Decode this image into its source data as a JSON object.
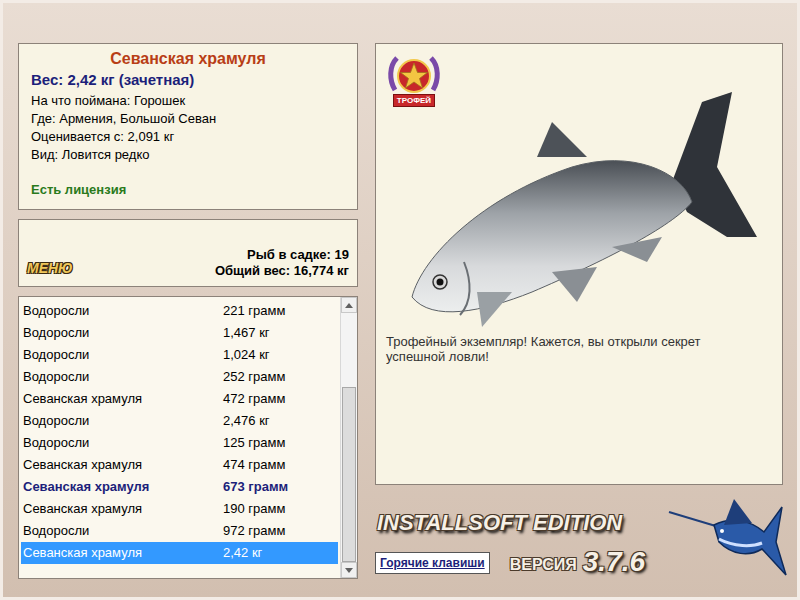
{
  "fish": {
    "name": "Севанская храмуля",
    "weight": "Вес: 2,42 кг (зачетная)",
    "details": [
      "На что поймана: Горошек",
      "Где: Армения, Большой Севан",
      "Оценивается с: 2,091 кг",
      "Вид: Ловится редко"
    ],
    "license": "Есть лицензия"
  },
  "keepnet": {
    "menu_button": "МЕНЮ",
    "count": "Рыб в садке: 19",
    "total": "Общий вес: 16,774 кг"
  },
  "catch_list": {
    "scroll": {
      "level": 1
    },
    "rows": [
      {
        "name": "Водоросли",
        "weight": "221 грамм",
        "highlighted": false,
        "selected": false
      },
      {
        "name": "Водоросли",
        "weight": "1,467 кг",
        "highlighted": false,
        "selected": false
      },
      {
        "name": "Водоросли",
        "weight": "1,024 кг",
        "highlighted": false,
        "selected": false
      },
      {
        "name": "Водоросли",
        "weight": "252 грамм",
        "highlighted": false,
        "selected": false
      },
      {
        "name": "Севанская храмуля",
        "weight": "472 грамм",
        "highlighted": false,
        "selected": false
      },
      {
        "name": "Водоросли",
        "weight": "2,476 кг",
        "highlighted": false,
        "selected": false
      },
      {
        "name": "Водоросли",
        "weight": "125 грамм",
        "highlighted": false,
        "selected": false
      },
      {
        "name": "Севанская храмуля",
        "weight": "474 грамм",
        "highlighted": false,
        "selected": false
      },
      {
        "name": "Севанская храмуля",
        "weight": "673 грамм",
        "highlighted": true,
        "selected": false
      },
      {
        "name": "Севанская храмуля",
        "weight": "190 грамм",
        "highlighted": false,
        "selected": false
      },
      {
        "name": "Водоросли",
        "weight": "972 грамм",
        "highlighted": false,
        "selected": false
      },
      {
        "name": "Севанская храмуля",
        "weight": "2,42 кг",
        "highlighted": false,
        "selected": true
      }
    ]
  },
  "trophy": {
    "badge": "ТРОФЕЙ",
    "message": "Трофейный экземпляр! Кажется, вы открыли секрет успешной ловли!"
  },
  "footer": {
    "brand": "INSTALLSOFT EDITION",
    "version_label": "ВЕРСИЯ",
    "version": "3.7.6",
    "hotkeys_button": "Горячие клавиши"
  }
}
